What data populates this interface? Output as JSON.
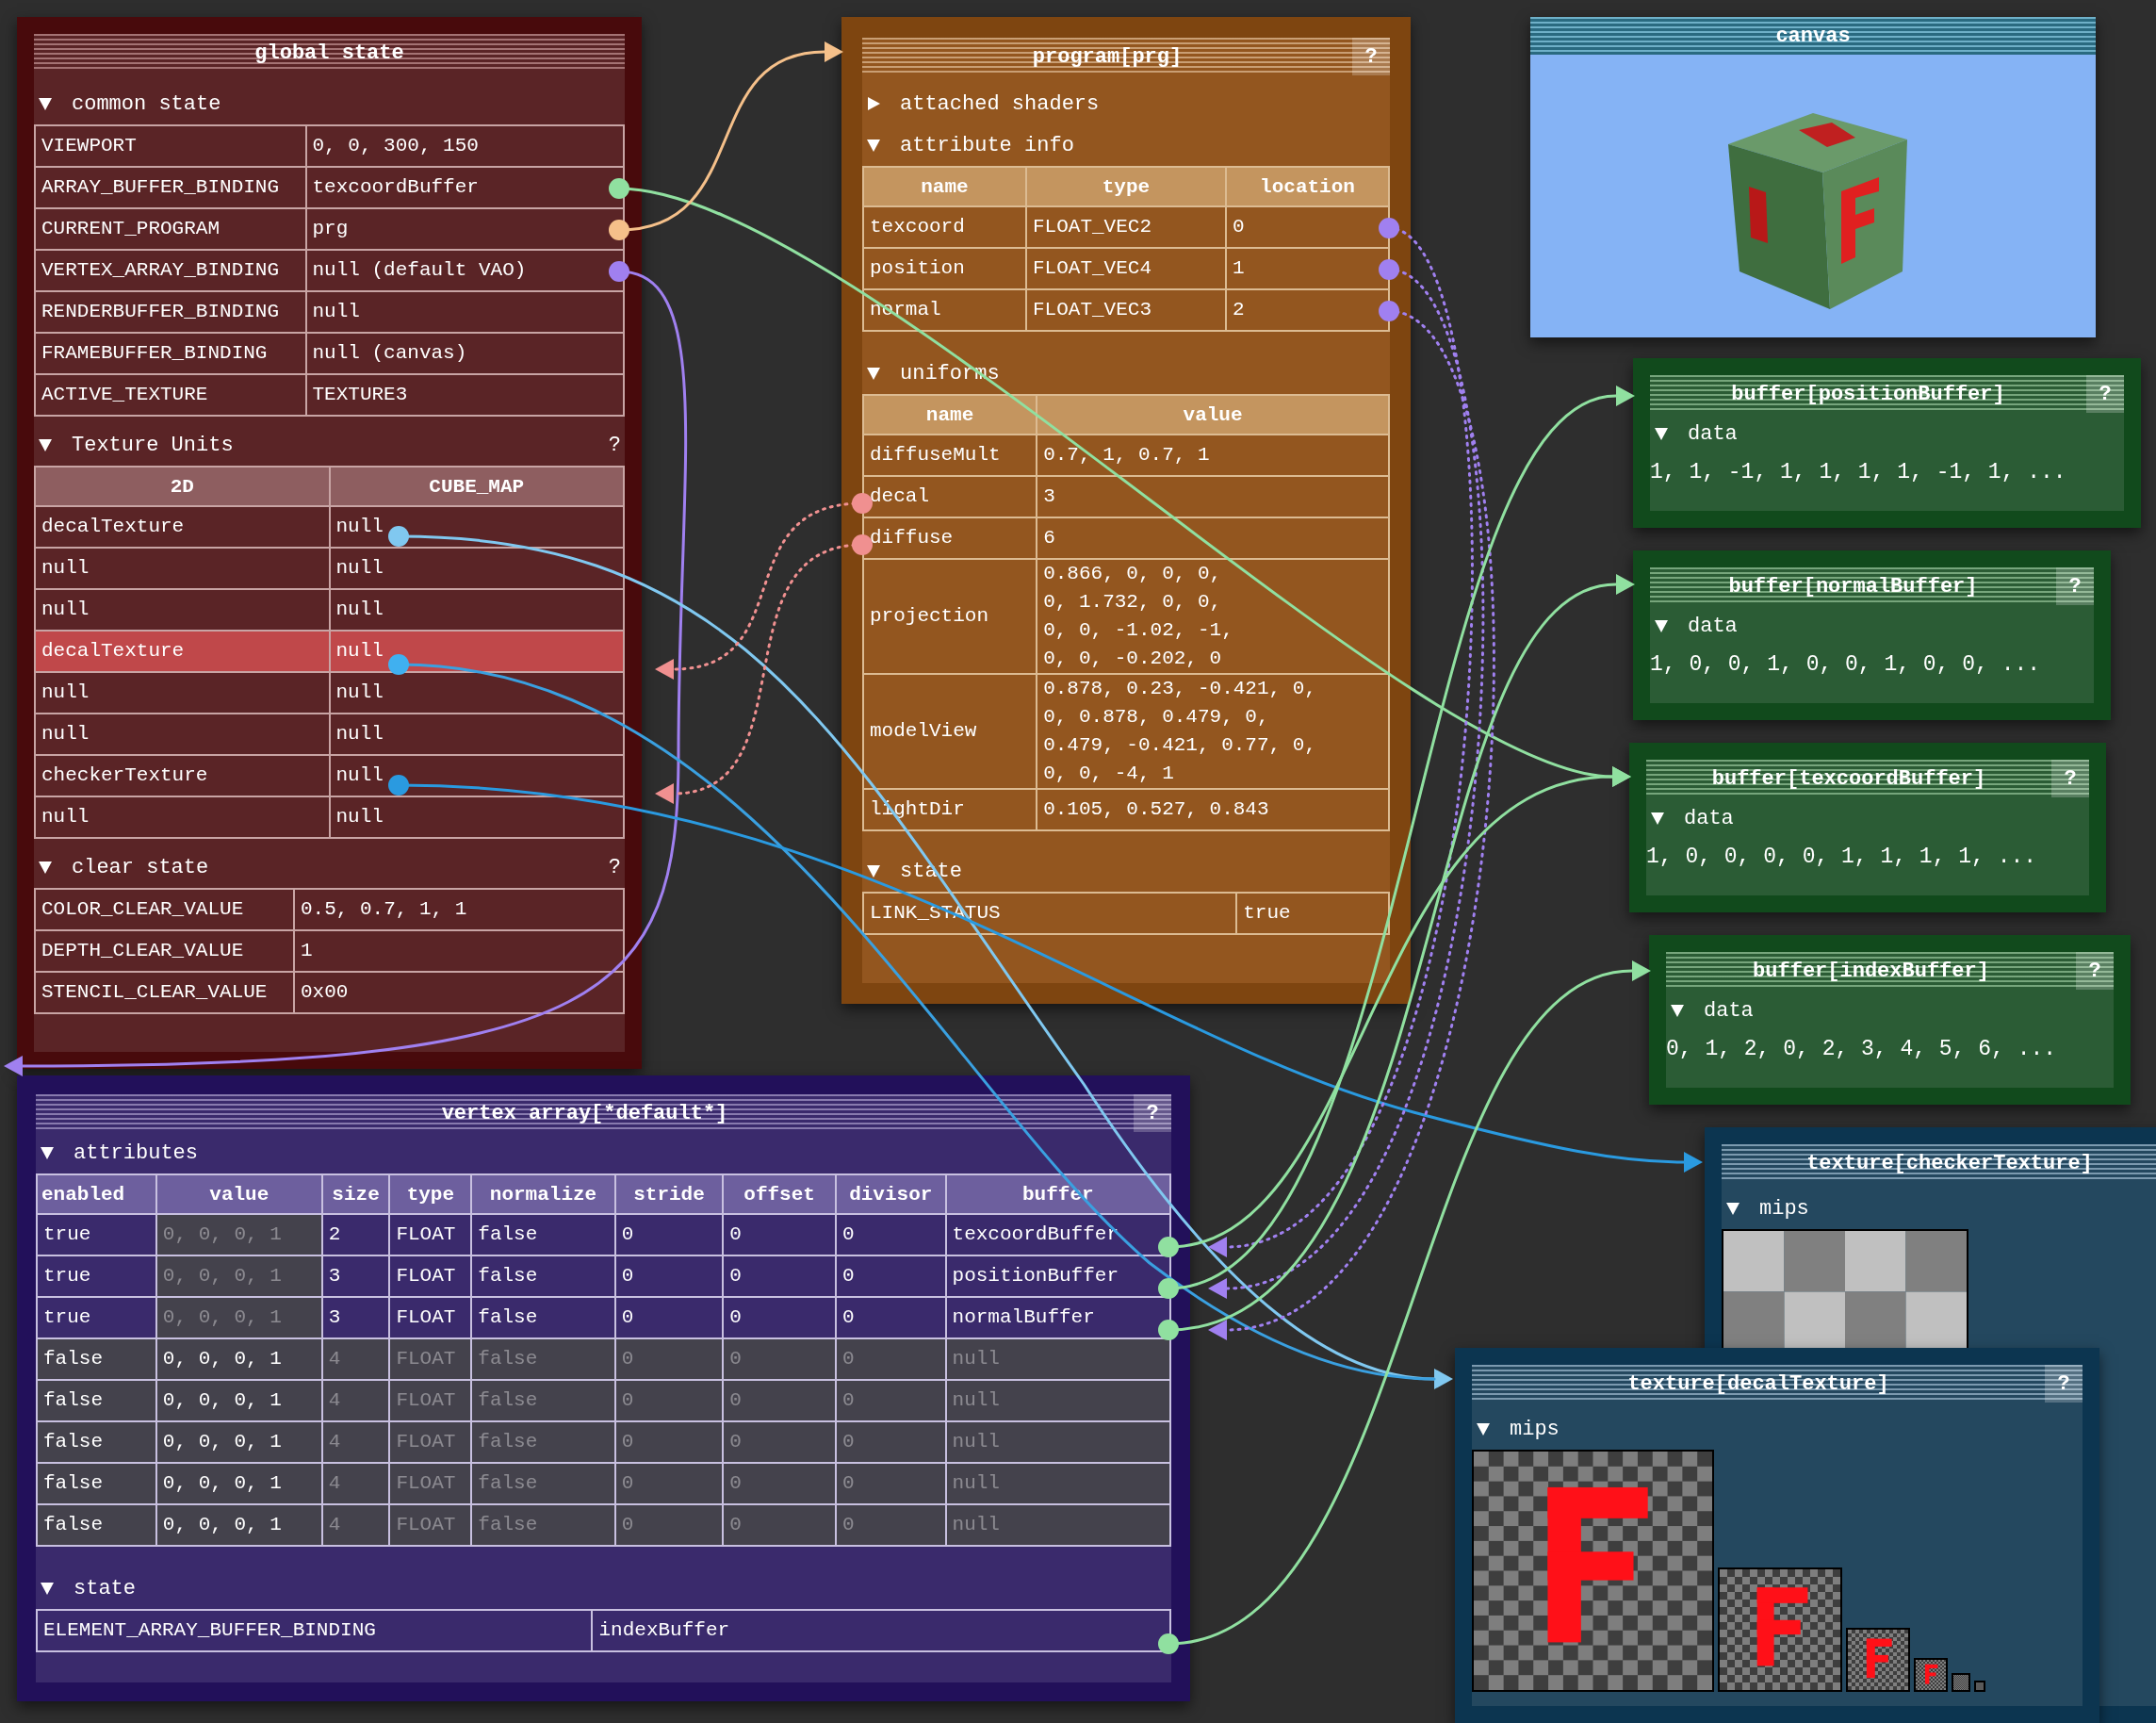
{
  "global_state": {
    "title": "global state",
    "common_state": {
      "label": "common state",
      "expanded": true,
      "rows": [
        {
          "name": "VIEWPORT",
          "value": "0, 0, 300, 150"
        },
        {
          "name": "ARRAY_BUFFER_BINDING",
          "value": "texcoordBuffer"
        },
        {
          "name": "CURRENT_PROGRAM",
          "value": "prg"
        },
        {
          "name": "VERTEX_ARRAY_BINDING",
          "value": "null (default VAO)"
        },
        {
          "name": "RENDERBUFFER_BINDING",
          "value": "null"
        },
        {
          "name": "FRAMEBUFFER_BINDING",
          "value": "null (canvas)"
        },
        {
          "name": "ACTIVE_TEXTURE",
          "value": "TEXTURE3"
        }
      ]
    },
    "texture_units": {
      "label": "Texture Units",
      "expanded": true,
      "help": "?",
      "columns": [
        "2D",
        "CUBE_MAP"
      ],
      "rows": [
        {
          "unit_2d": "decalTexture",
          "cube_map": "null",
          "selected": false
        },
        {
          "unit_2d": "null",
          "cube_map": "null",
          "selected": false
        },
        {
          "unit_2d": "null",
          "cube_map": "null",
          "selected": false
        },
        {
          "unit_2d": "decalTexture",
          "cube_map": "null",
          "selected": true
        },
        {
          "unit_2d": "null",
          "cube_map": "null",
          "selected": false
        },
        {
          "unit_2d": "null",
          "cube_map": "null",
          "selected": false
        },
        {
          "unit_2d": "checkerTexture",
          "cube_map": "null",
          "selected": false
        },
        {
          "unit_2d": "null",
          "cube_map": "null",
          "selected": false
        }
      ]
    },
    "clear_state": {
      "label": "clear state",
      "expanded": true,
      "help": "?",
      "rows": [
        {
          "name": "COLOR_CLEAR_VALUE",
          "value": "0.5, 0.7, 1, 1"
        },
        {
          "name": "DEPTH_CLEAR_VALUE",
          "value": "1"
        },
        {
          "name": "STENCIL_CLEAR_VALUE",
          "value": "0x00"
        }
      ]
    }
  },
  "program": {
    "title": "program[prg]",
    "help": "?",
    "attached_shaders": {
      "label": "attached shaders",
      "expanded": false
    },
    "attribute_info": {
      "label": "attribute info",
      "expanded": true,
      "columns": [
        "name",
        "type",
        "location"
      ],
      "rows": [
        [
          "texcoord",
          "FLOAT_VEC2",
          "0"
        ],
        [
          "position",
          "FLOAT_VEC4",
          "1"
        ],
        [
          "normal",
          "FLOAT_VEC3",
          "2"
        ]
      ]
    },
    "uniforms": {
      "label": "uniforms",
      "expanded": true,
      "columns": [
        "name",
        "value"
      ],
      "rows": [
        {
          "name": "diffuseMult",
          "value": [
            "0.7, 1, 0.7, 1"
          ]
        },
        {
          "name": "decal",
          "value": [
            "3"
          ]
        },
        {
          "name": "diffuse",
          "value": [
            "6"
          ]
        },
        {
          "name": "projection",
          "value": [
            "0.866, 0, 0, 0,",
            "0, 1.732, 0, 0,",
            "0, 0, -1.02, -1,",
            "0, 0, -0.202, 0"
          ]
        },
        {
          "name": "modelView",
          "value": [
            "0.878, 0.23, -0.421, 0,",
            "0, 0.878, 0.479, 0,",
            "0.479, -0.421, 0.77, 0,",
            "0, 0, -4, 1"
          ]
        },
        {
          "name": "lightDir",
          "value": [
            "0.105, 0.527, 0.843"
          ]
        }
      ]
    },
    "state": {
      "label": "state",
      "expanded": true,
      "rows": [
        {
          "name": "LINK_STATUS",
          "value": "true"
        }
      ]
    }
  },
  "canvas": {
    "title": "canvas"
  },
  "buffers": [
    {
      "title": "buffer[positionBuffer]",
      "help": "?",
      "data_label": "data",
      "expanded": true,
      "data": "1, 1, -1, 1, 1, 1, 1, -1, 1, ..."
    },
    {
      "title": "buffer[normalBuffer]",
      "help": "?",
      "data_label": "data",
      "expanded": true,
      "data": "1, 0, 0, 1, 0, 0, 1, 0, 0, ..."
    },
    {
      "title": "buffer[texcoordBuffer]",
      "help": "?",
      "data_label": "data",
      "expanded": true,
      "data": "1, 0, 0, 0, 0, 1, 1, 1, 1, ..."
    },
    {
      "title": "buffer[indexBuffer]",
      "help": "?",
      "data_label": "data",
      "expanded": true,
      "data": "0, 1, 2, 0, 2, 3, 4, 5, 6, ..."
    }
  ],
  "textures": [
    {
      "title": "texture[checkerTexture]",
      "kind": "checker",
      "mips_label": "mips",
      "expanded": true
    },
    {
      "title": "texture[decalTexture]",
      "kind": "decal",
      "help": "?",
      "mips_label": "mips",
      "expanded": true
    }
  ],
  "vertex_array": {
    "title": "vertex array[*default*]",
    "help": "?",
    "attributes": {
      "label": "attributes",
      "expanded": true,
      "columns": [
        "enabled",
        "value",
        "size",
        "type",
        "normalize",
        "stride",
        "offset",
        "divisor",
        "buffer"
      ],
      "rows": [
        {
          "in_use": true,
          "cells": [
            "true",
            "0, 0, 0, 1",
            "2",
            "FLOAT",
            "false",
            "0",
            "0",
            "0",
            "texcoordBuffer"
          ]
        },
        {
          "in_use": true,
          "cells": [
            "true",
            "0, 0, 0, 1",
            "3",
            "FLOAT",
            "false",
            "0",
            "0",
            "0",
            "positionBuffer"
          ]
        },
        {
          "in_use": true,
          "cells": [
            "true",
            "0, 0, 0, 1",
            "3",
            "FLOAT",
            "false",
            "0",
            "0",
            "0",
            "normalBuffer"
          ]
        },
        {
          "in_use": false,
          "cells": [
            "false",
            "0, 0, 0, 1",
            "4",
            "FLOAT",
            "false",
            "0",
            "0",
            "0",
            "null"
          ]
        },
        {
          "in_use": false,
          "cells": [
            "false",
            "0, 0, 0, 1",
            "4",
            "FLOAT",
            "false",
            "0",
            "0",
            "0",
            "null"
          ]
        },
        {
          "in_use": false,
          "cells": [
            "false",
            "0, 0, 0, 1",
            "4",
            "FLOAT",
            "false",
            "0",
            "0",
            "0",
            "null"
          ]
        },
        {
          "in_use": false,
          "cells": [
            "false",
            "0, 0, 0, 1",
            "4",
            "FLOAT",
            "false",
            "0",
            "0",
            "0",
            "null"
          ]
        },
        {
          "in_use": false,
          "cells": [
            "false",
            "0, 0, 0, 1",
            "4",
            "FLOAT",
            "false",
            "0",
            "0",
            "0",
            "null"
          ]
        }
      ]
    },
    "state": {
      "label": "state",
      "expanded": true,
      "rows": [
        {
          "name": "ELEMENT_ARRAY_BUFFER_BINDING",
          "value": "indexBuffer"
        }
      ]
    }
  }
}
